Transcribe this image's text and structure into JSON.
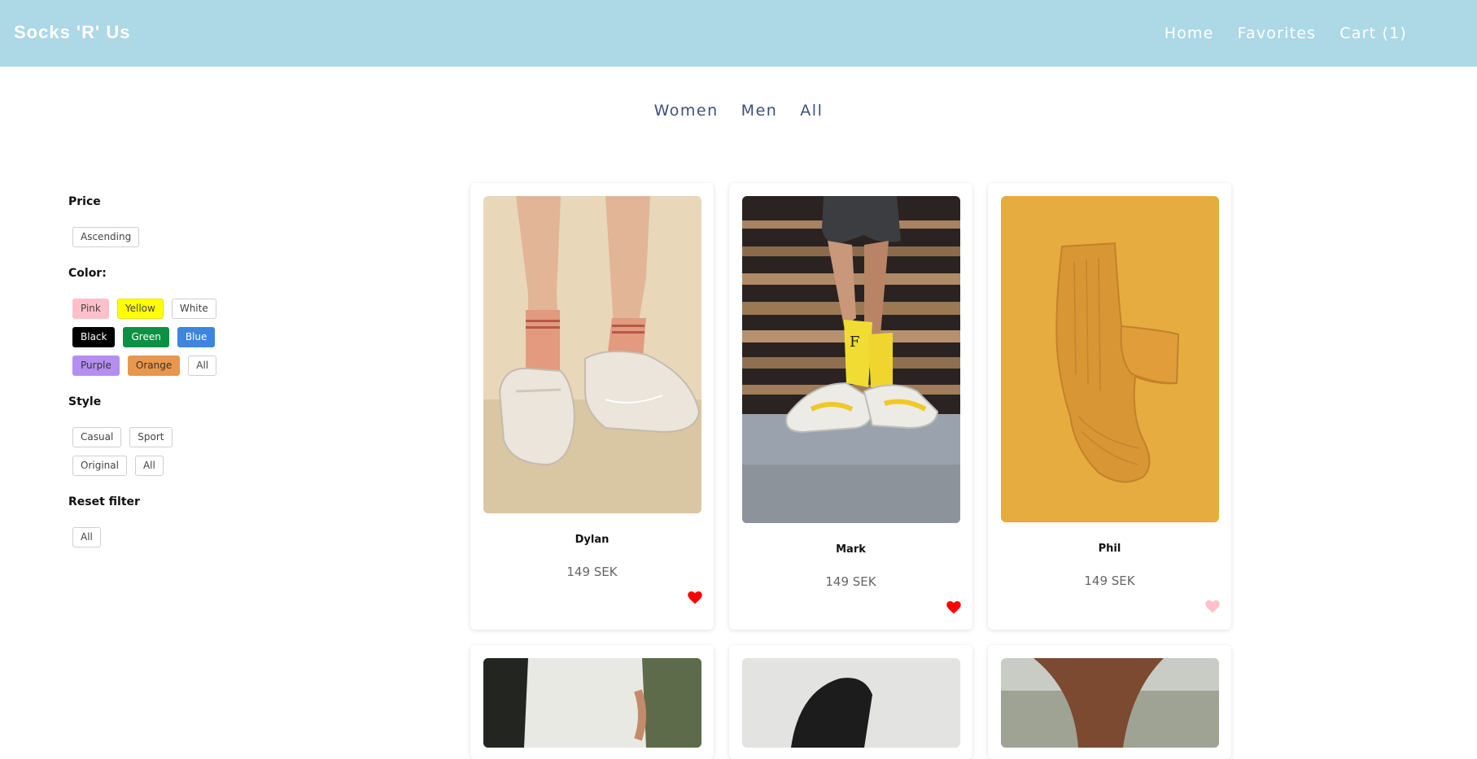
{
  "header": {
    "brand": "Socks 'R' Us",
    "nav": [
      "Home",
      "Favorites",
      "Cart (1)"
    ]
  },
  "category_nav": [
    "Women",
    "Men",
    "All"
  ],
  "filters": {
    "price": {
      "title": "Price",
      "options": [
        "Ascending"
      ]
    },
    "color": {
      "title": "Color:",
      "options": [
        "Pink",
        "Yellow",
        "White",
        "Black",
        "Green",
        "Blue",
        "Purple",
        "Orange",
        "All"
      ]
    },
    "style": {
      "title": "Style",
      "options": [
        "Casual",
        "Sport",
        "Original",
        "All"
      ]
    },
    "reset": {
      "title": "Reset filter",
      "options": [
        "All"
      ]
    }
  },
  "colors": {
    "header_bg": "#add8e6",
    "heart_favorite": "#ff0000",
    "heart_default": "#ffc0cb"
  },
  "products": [
    {
      "name": "Dylan",
      "price": "149 SEK",
      "favorite": true
    },
    {
      "name": "Mark",
      "price": "149 SEK",
      "favorite": true
    },
    {
      "name": "Phil",
      "price": "149 SEK",
      "favorite": false
    }
  ]
}
